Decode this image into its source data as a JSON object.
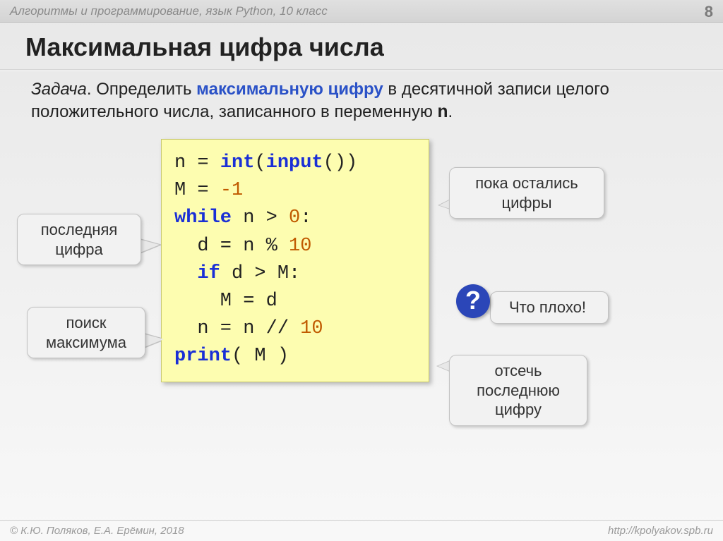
{
  "header": {
    "breadcrumb": "Алгоритмы и программирование, язык Python, 10 класс",
    "page_number": "8"
  },
  "title": "Максимальная цифра числа",
  "task": {
    "label": "Задача",
    "text_before": ". Определить ",
    "highlight": "максимальную цифру",
    "text_mid": " в десятичной записи целого положительного числа, записанного в переменную ",
    "var": "n",
    "text_after": "."
  },
  "code": {
    "l1a": "n = ",
    "l1b": "int",
    "l1c": "(",
    "l1d": "input",
    "l1e": "())",
    "l2a": "M",
    "l2b": " = ",
    "l2c": "-1",
    "l3a": "while",
    "l3b": " n > ",
    "l3c": "0",
    "l3d": ":",
    "l4a": "  d = n % ",
    "l4b": "10",
    "l5a": "  ",
    "l5b": "if",
    "l5c": " d > M:",
    "l6": "    M = d",
    "l7a": "  n = n // ",
    "l7b": "10",
    "l8a": "print",
    "l8b": "( M )"
  },
  "callouts": {
    "c1": "пока остались цифры",
    "c2": "последняя цифра",
    "c3": "поиск максимума",
    "c4": "Что плохо!",
    "c5": "отсечь последнюю цифру",
    "q": "?"
  },
  "footer": {
    "left": "© К.Ю. Поляков, Е.А. Ерёмин, 2018",
    "right": "http://kpolyakov.spb.ru"
  }
}
